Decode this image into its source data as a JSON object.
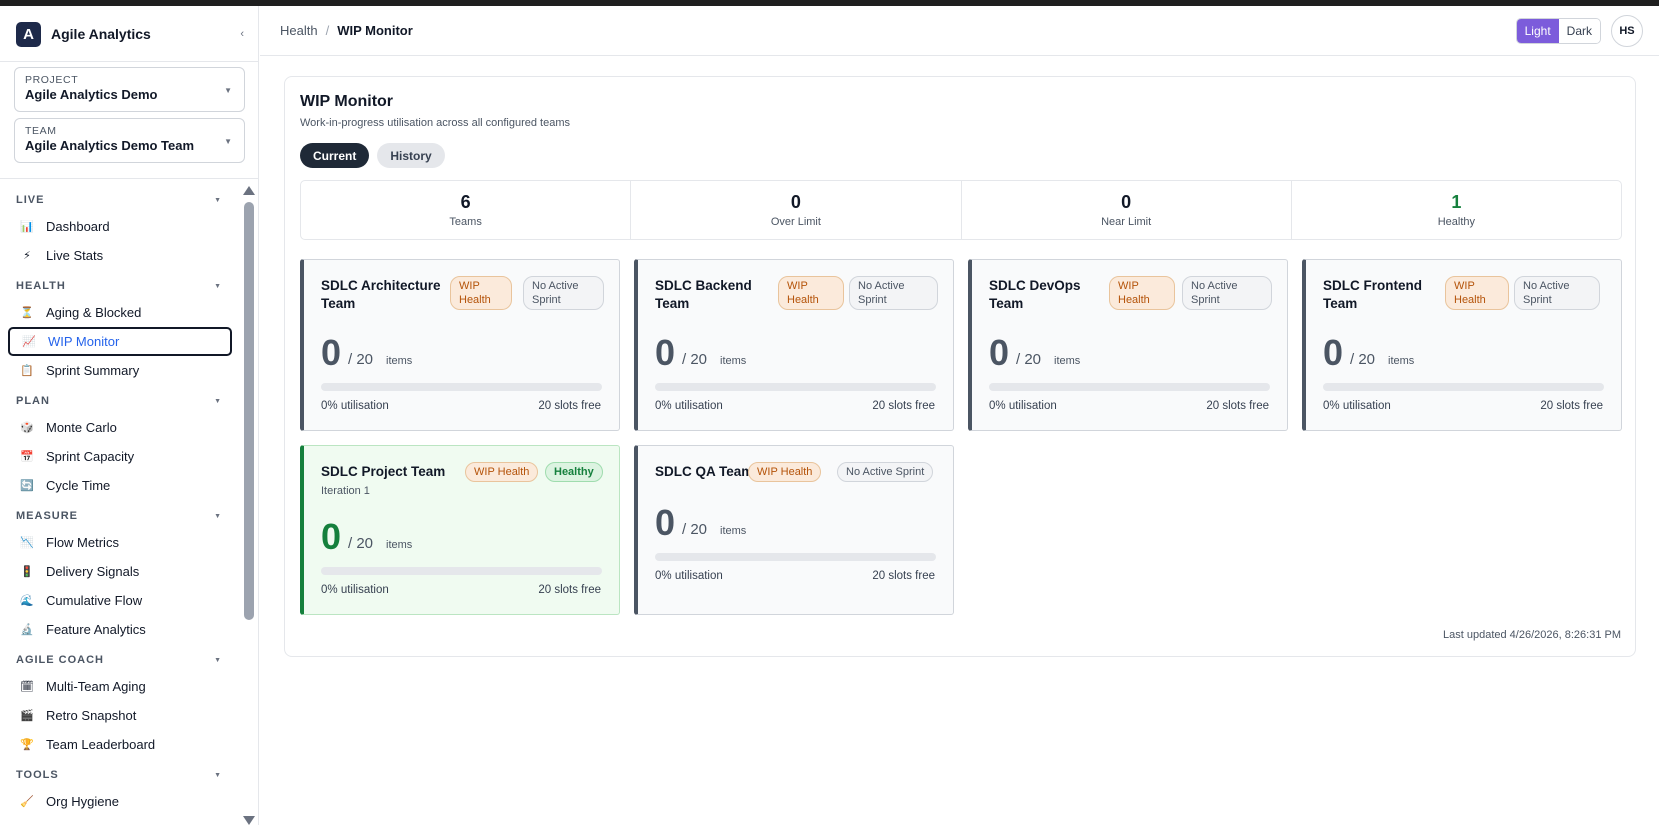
{
  "brand": {
    "logo_letter": "A",
    "name": "Agile Analytics",
    "collapse_glyph": "‹"
  },
  "pickers": [
    {
      "label": "PROJECT",
      "value": "Agile Analytics Demo"
    },
    {
      "label": "TEAM",
      "value": "Agile Analytics Demo Team"
    }
  ],
  "nav": {
    "sections": [
      {
        "label": "LIVE",
        "items": [
          {
            "label": "Dashboard",
            "icon": "bar-chart-icon",
            "glyph": "📊"
          },
          {
            "label": "Live Stats",
            "icon": "lightning-icon",
            "glyph": "⚡"
          }
        ]
      },
      {
        "label": "HEALTH",
        "items": [
          {
            "label": "Aging & Blocked",
            "icon": "hourglass-icon",
            "glyph": "⏳"
          },
          {
            "label": "WIP Monitor",
            "icon": "trend-chart-icon",
            "glyph": "📈"
          },
          {
            "label": "Sprint Summary",
            "icon": "clipboard-icon",
            "glyph": "📋"
          }
        ]
      },
      {
        "label": "PLAN",
        "items": [
          {
            "label": "Monte Carlo",
            "icon": "dice-icon",
            "glyph": "🎲"
          },
          {
            "label": "Sprint Capacity",
            "icon": "calendar-icon",
            "glyph": "📅"
          },
          {
            "label": "Cycle Time",
            "icon": "cycle-icon",
            "glyph": "🔄"
          }
        ]
      },
      {
        "label": "MEASURE",
        "items": [
          {
            "label": "Flow Metrics",
            "icon": "down-trend-icon",
            "glyph": "📉"
          },
          {
            "label": "Delivery Signals",
            "icon": "traffic-light-icon",
            "glyph": "🚦"
          },
          {
            "label": "Cumulative Flow",
            "icon": "wave-icon",
            "glyph": "🌊"
          },
          {
            "label": "Feature Analytics",
            "icon": "microscope-icon",
            "glyph": "🔬"
          }
        ]
      },
      {
        "label": "AGILE COACH",
        "items": [
          {
            "label": "Multi-Team Aging",
            "icon": "calendar-grid-icon",
            "glyph": "🗓"
          },
          {
            "label": "Retro Snapshot",
            "icon": "clapperboard-icon",
            "glyph": "🎬"
          },
          {
            "label": "Team Leaderboard",
            "icon": "trophy-icon",
            "glyph": "🏆"
          }
        ]
      },
      {
        "label": "TOOLS",
        "items": [
          {
            "label": "Org Hygiene",
            "icon": "broom-icon",
            "glyph": "🧹"
          }
        ]
      }
    ]
  },
  "header": {
    "crumb_parent": "Health",
    "crumb_sep": "/",
    "crumb_current": "WIP Monitor",
    "theme_light": "Light",
    "theme_dark": "Dark",
    "avatar": "HS"
  },
  "panel": {
    "title": "WIP Monitor",
    "subtitle": "Work-in-progress utilisation across all configured teams",
    "tabs": {
      "current": "Current",
      "history": "History"
    },
    "stats": [
      {
        "value": "6",
        "label": "Teams"
      },
      {
        "value": "0",
        "label": "Over Limit"
      },
      {
        "value": "0",
        "label": "Near Limit"
      },
      {
        "value": "1",
        "label": "Healthy"
      }
    ],
    "updated": "Last updated 4/26/2026, 8:26:31 PM"
  },
  "teams": [
    {
      "name": "SDLC Architecture Team",
      "badge1": "WIP Health",
      "badge2": "No Active Sprint",
      "count": "0",
      "limit": "/ 20",
      "unit": "items",
      "utilisation_fraction": 0,
      "util_text": "0% utilisation",
      "free_text": "20 slots free"
    },
    {
      "name": "SDLC Backend Team",
      "badge1": "WIP Health",
      "badge2": "No Active Sprint",
      "count": "0",
      "limit": "/ 20",
      "unit": "items",
      "utilisation_fraction": 0,
      "util_text": "0% utilisation",
      "free_text": "20 slots free"
    },
    {
      "name": "SDLC DevOps Team",
      "badge1": "WIP Health",
      "badge2": "No Active Sprint",
      "count": "0",
      "limit": "/ 20",
      "unit": "items",
      "utilisation_fraction": 0,
      "util_text": "0% utilisation",
      "free_text": "20 slots free"
    },
    {
      "name": "SDLC Frontend Team",
      "badge1": "WIP Health",
      "badge2": "No Active Sprint",
      "count": "0",
      "limit": "/ 20",
      "unit": "items",
      "utilisation_fraction": 0,
      "util_text": "0% utilisation",
      "free_text": "20 slots free"
    },
    {
      "name": "SDLC Project Team",
      "subtitle": "Iteration 1",
      "badge1": "WIP Health",
      "badge2": "Healthy",
      "count": "0",
      "limit": "/ 20",
      "unit": "items",
      "utilisation_fraction": 0,
      "util_text": "0% utilisation",
      "free_text": "20 slots free"
    },
    {
      "name": "SDLC QA Team",
      "badge1": "WIP Health",
      "badge2": "No Active Sprint",
      "count": "0",
      "limit": "/ 20",
      "unit": "items",
      "utilisation_fraction": 0,
      "util_text": "0% utilisation",
      "free_text": "20 slots free"
    }
  ],
  "colors": {
    "accent": "#7c5cdb",
    "active_link": "#2563eb",
    "healthy": "#15803d",
    "wip_badge": "#b45309"
  }
}
